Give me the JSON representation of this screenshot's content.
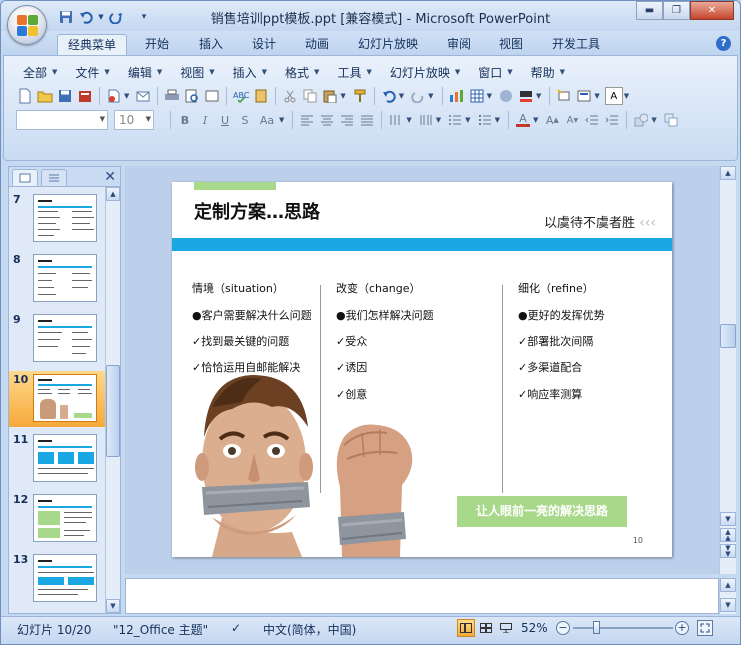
{
  "window": {
    "title": "销售培训ppt模板.ppt [兼容模式] - Microsoft PowerPoint"
  },
  "quick_access": {
    "icons": [
      "save-icon",
      "undo-icon",
      "redo-icon",
      "customize-icon"
    ]
  },
  "tabs": [
    "经典菜单",
    "开始",
    "插入",
    "设计",
    "动画",
    "幻灯片放映",
    "审阅",
    "视图",
    "开发工具"
  ],
  "active_tab": "经典菜单",
  "classic_menu": [
    "全部",
    "文件",
    "编辑",
    "视图",
    "插入",
    "格式",
    "工具",
    "幻灯片放映",
    "窗口",
    "帮助"
  ],
  "font_size": "10",
  "thumbnails": [
    {
      "num": "7",
      "selected": false
    },
    {
      "num": "8",
      "selected": false
    },
    {
      "num": "9",
      "selected": false
    },
    {
      "num": "10",
      "selected": true
    },
    {
      "num": "11",
      "selected": false
    },
    {
      "num": "12",
      "selected": false
    },
    {
      "num": "13",
      "selected": false
    }
  ],
  "slide": {
    "title": "定制方案…思路",
    "subtitle": "以虞待不虞者胜",
    "subtitle_arrows": "‹‹‹",
    "columns": [
      {
        "title": "情境（situation）",
        "items": [
          "●客户需要解决什么问题",
          "✓找到最关键的问题",
          "✓恰恰运用自邮能解决"
        ]
      },
      {
        "title": "改变（change）",
        "items": [
          "●我们怎样解决问题",
          "✓受众",
          "✓诱因",
          "✓创意"
        ]
      },
      {
        "title": "细化（refine）",
        "items": [
          "●更好的发挥优势",
          "✓部署批次间隔",
          "✓多渠道配合",
          "✓响应率测算"
        ]
      }
    ],
    "cta": "让人眼前一亮的解决思路",
    "page_number": "10"
  },
  "status": {
    "slide_info": "幻灯片 10/20",
    "theme": "\"12_Office 主题\"",
    "language": "中文(简体，中国)",
    "zoom": "52%"
  }
}
